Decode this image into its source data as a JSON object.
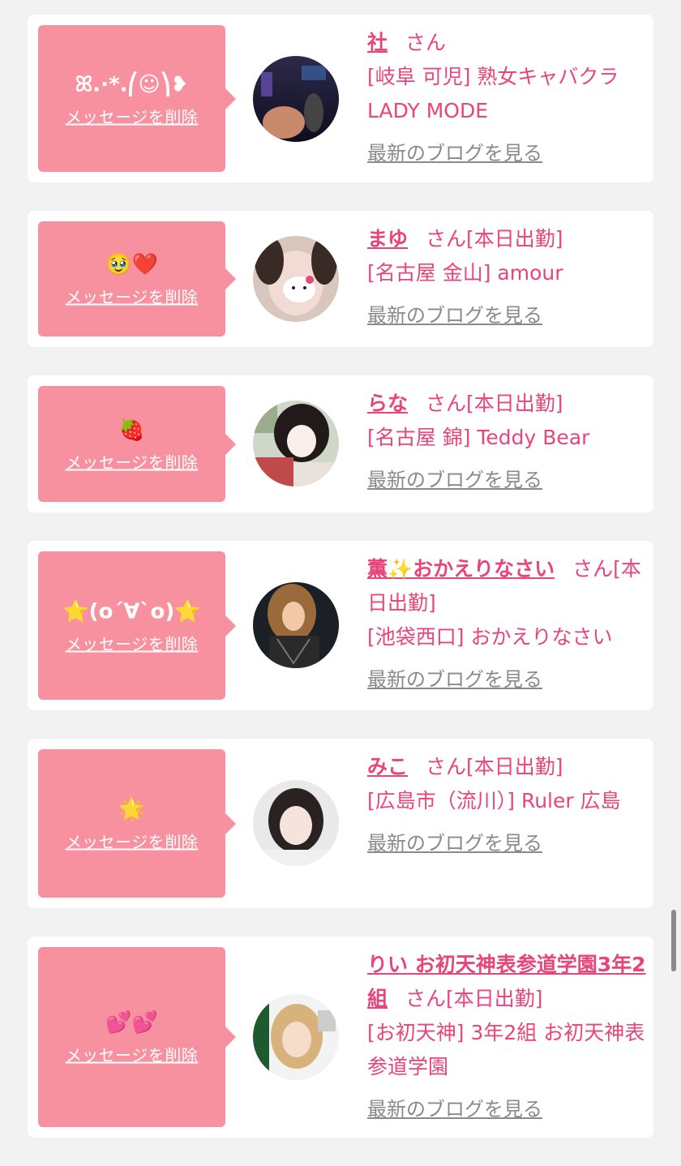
{
  "items": [
    {
      "message": "ꕤ.·*.⎛☺︎⎞❥",
      "delete_label": "メッセージを削除",
      "name": "社",
      "san": "さん",
      "attendance": "",
      "shop": "[岐阜 可児] 熟女キャバクラLADY MODE",
      "blog_label": "最新のブログを見る",
      "avatar_icon": "avatar-photo"
    },
    {
      "message": "🥹❤️",
      "delete_label": "メッセージを削除",
      "name": "まゆ",
      "san": "さん",
      "attendance": "[本日出勤]",
      "shop": "[名古屋 金山] amour",
      "blog_label": "最新のブログを見る",
      "avatar_icon": "avatar-photo"
    },
    {
      "message": "🍓",
      "delete_label": "メッセージを削除",
      "name": "らな",
      "san": "さん",
      "attendance": "[本日出勤]",
      "shop": "[名古屋 錦] Teddy Bear",
      "blog_label": "最新のブログを見る",
      "avatar_icon": "avatar-photo"
    },
    {
      "message": "⭐(o´∀`o)⭐",
      "delete_label": "メッセージを削除",
      "name": "薫✨おかえりなさい",
      "san": "さん",
      "attendance": "[本日出勤]",
      "shop": "[池袋西口] おかえりなさい",
      "blog_label": "最新のブログを見る",
      "avatar_icon": "avatar-photo"
    },
    {
      "message": "🌟",
      "delete_label": "メッセージを削除",
      "name": "みこ",
      "san": "さん",
      "attendance": "[本日出勤]",
      "shop": "[広島市（流川）] Ruler 広島",
      "blog_label": "最新のブログを見る",
      "avatar_icon": "avatar-photo"
    },
    {
      "message": "💕💕",
      "delete_label": "メッセージを削除",
      "name": "りい お初天神表参道学園3年2組",
      "san": "さん",
      "attendance": "[本日出勤]",
      "shop": "[お初天神] 3年2組 お初天神表参道学園",
      "blog_label": "最新のブログを見る",
      "avatar_icon": "avatar-photo"
    }
  ],
  "colors": {
    "accent": "#e8457a",
    "bubble": "#f8919f",
    "link_gray": "#8a8a8a",
    "background": "#f2f2f2"
  }
}
